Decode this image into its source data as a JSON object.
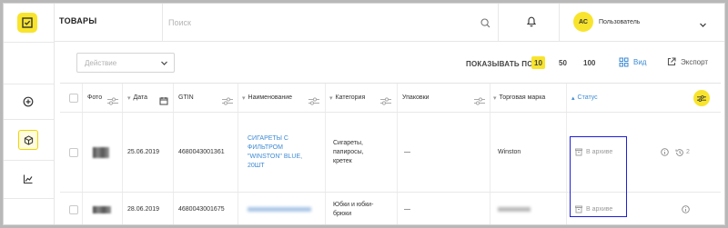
{
  "header": {
    "title": "ТОВАРЫ",
    "search_placeholder": "Поиск",
    "user": {
      "initials": "АС",
      "name": "Пользователь"
    }
  },
  "toolbar": {
    "action_placeholder": "Действие",
    "show_label": "ПОКАЗЫВАТЬ ПО:",
    "page_sizes": [
      "10",
      "50",
      "100"
    ],
    "selected_page_size": "10",
    "view_label": "Вид",
    "export_label": "Экспорт"
  },
  "table": {
    "columns": [
      "Фото",
      "Дата",
      "GTIN",
      "Наименование",
      "Категория",
      "Упаковки",
      "Торговая марка",
      "Статус"
    ],
    "rows": [
      {
        "date": "25.06.2019",
        "gtin": "4680043001361",
        "name_lines": [
          "СИГАРЕТЫ С",
          "ФИЛЬТРОМ",
          "\"WINSTON\" BLUE,",
          "20ШТ"
        ],
        "category_lines": [
          "Сигареты,",
          "папиросы,",
          "кретек"
        ],
        "packages": "—",
        "brand": "Winston",
        "status": "В архиве",
        "history_count": "2"
      },
      {
        "date": "28.06.2019",
        "gtin": "4680043001675",
        "name": "",
        "category_lines": [
          "Юбки и юбки-",
          "брюки"
        ],
        "packages": "—",
        "brand": "",
        "status": "В архиве"
      }
    ]
  },
  "colors": {
    "accent": "#f8e42d",
    "link": "#3d8ad3",
    "highlight": "#1f1fd8"
  }
}
